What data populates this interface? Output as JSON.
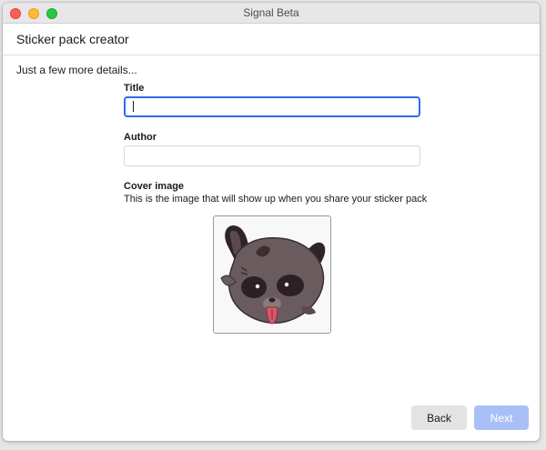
{
  "window": {
    "title": "Signal Beta"
  },
  "header": {
    "title": "Sticker pack creator"
  },
  "form": {
    "heading": "Just a few more details...",
    "title_label": "Title",
    "title_value": "",
    "author_label": "Author",
    "author_value": "",
    "cover_label": "Cover image",
    "cover_helper": "This is the image that will show up when you share your sticker pack"
  },
  "footer": {
    "back_label": "Back",
    "next_label": "Next"
  },
  "colors": {
    "accent": "#2c6bed",
    "next_disabled": "#a9c0f7"
  }
}
